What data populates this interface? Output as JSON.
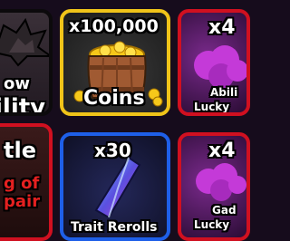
{
  "tiles": {
    "shadow_ability": {
      "title_fragment_1": "ow",
      "title_fragment_2": "ility",
      "icon": "bat-wing-icon"
    },
    "coins": {
      "amount": "x100,000",
      "label": "Coins",
      "icon": "coin-barrel-icon",
      "border_color": "#f0c419"
    },
    "ability_lucky": {
      "amount_fragment": "x4",
      "label_line_1": "Abili",
      "label_line_2": "Lucky",
      "icon": "purple-blob-icon",
      "border_color": "#d01020"
    },
    "battle": {
      "title_fragment": "tle",
      "subtitle_line_1": "g of",
      "subtitle_line_2": "pair",
      "border_color": "#d01020"
    },
    "trait_rerolls": {
      "amount": "x30",
      "label": "Trait Rerolls",
      "icon": "crystal-icon",
      "border_color": "#1e5fe8"
    },
    "gadget_lucky": {
      "amount_fragment": "x4",
      "label_line_1": "Gad",
      "label_line_2": "Lucky",
      "icon": "purple-blob-icon",
      "border_color": "#d01020"
    }
  }
}
